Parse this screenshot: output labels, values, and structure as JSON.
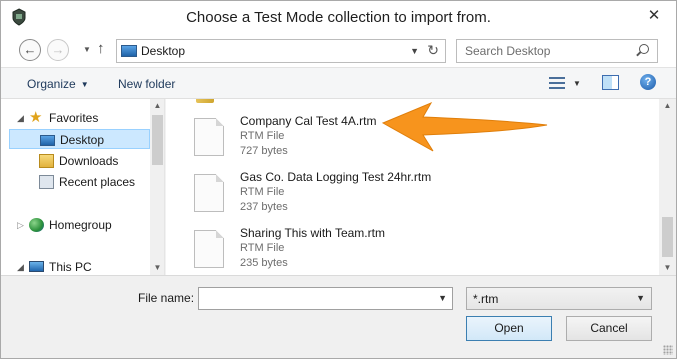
{
  "window": {
    "title": "Choose a Test Mode collection to import from.",
    "close_glyph": "✕"
  },
  "address": {
    "location": "Desktop",
    "search_placeholder": "Search Desktop"
  },
  "toolbar": {
    "organize_label": "Organize",
    "new_folder_label": "New folder",
    "help_glyph": "?"
  },
  "nav": {
    "favorites": "Favorites",
    "desktop": "Desktop",
    "downloads": "Downloads",
    "recent_places": "Recent places",
    "homegroup": "Homegroup",
    "this_pc": "This PC"
  },
  "files": [
    {
      "name": "Company Cal Test 4A.rtm",
      "type": "RTM File",
      "size": "727 bytes"
    },
    {
      "name": "Gas Co. Data Logging Test 24hr.rtm",
      "type": "RTM File",
      "size": "237 bytes"
    },
    {
      "name": "Sharing This with Team.rtm",
      "type": "RTM File",
      "size": "235 bytes"
    }
  ],
  "bottom": {
    "filename_label": "File name:",
    "filename_value": "",
    "filter_value": "*.rtm",
    "open_label": "Open",
    "cancel_label": "Cancel"
  },
  "colors": {
    "annotation_arrow": "#f7941d",
    "selection": "#cce8ff"
  }
}
